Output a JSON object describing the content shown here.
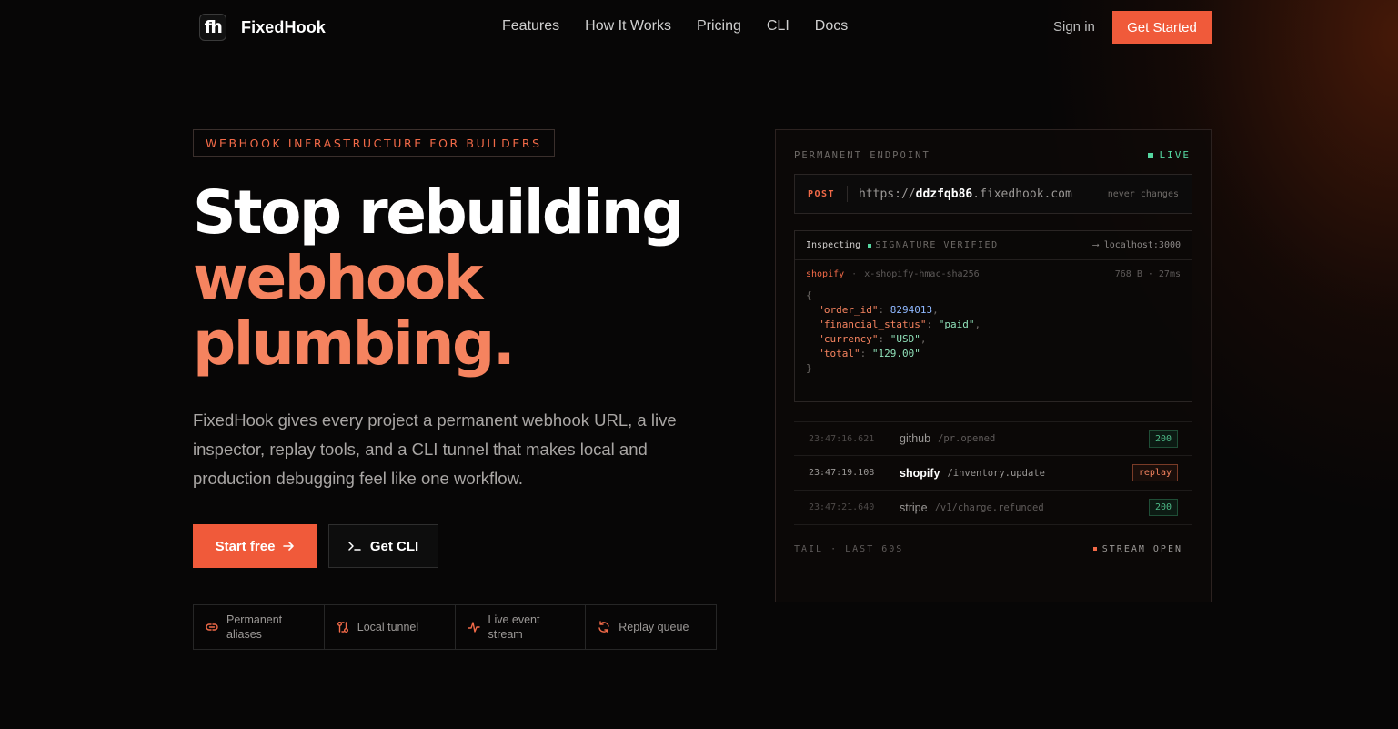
{
  "nav": {
    "logo_mark": "fh",
    "brand": "FixedHook",
    "links": [
      "Features",
      "How It Works",
      "Pricing",
      "CLI",
      "Docs"
    ],
    "signin": "Sign in",
    "cta": "Get Started"
  },
  "hero": {
    "tag": "WEBHOOK INFRASTRUCTURE FOR BUILDERS",
    "headline_1": "Stop rebuilding",
    "headline_2": "webhook",
    "headline_3": "plumbing.",
    "lede": "FixedHook gives every project a permanent webhook URL, a live inspector, replay tools, and a CLI tunnel that makes local and production debugging feel like one workflow.",
    "primary_cta": "Start free",
    "secondary_cta": "Get CLI",
    "features": [
      {
        "label": "Permanent aliases",
        "icon": "link-icon"
      },
      {
        "label": "Local tunnel",
        "icon": "tunnel-icon"
      },
      {
        "label": "Live event stream",
        "icon": "pulse-icon"
      },
      {
        "label": "Replay queue",
        "icon": "refresh-icon"
      }
    ]
  },
  "panel": {
    "label": "PERMANENT ENDPOINT",
    "live": "LIVE",
    "method": "POST",
    "url_prefix": "https://",
    "url_id": "ddzfqb86",
    "url_suffix": ".fixedhook.com",
    "url_note": "never changes",
    "inspector": {
      "title": "Inspecting",
      "verified": "SIGNATURE VERIFIED",
      "route": "⟶ localhost:3000",
      "source": "shopify",
      "header": "x-shopify-hmac-sha256",
      "meta": "768 B · 27ms",
      "payload": {
        "order_id_key": "\"order_id\"",
        "order_id_val": "8294013",
        "financial_status_key": "\"financial_status\"",
        "financial_status_val": "\"paid\"",
        "currency_key": "\"currency\"",
        "currency_val": "\"USD\"",
        "total_key": "\"total\"",
        "total_val": "\"129.00\""
      }
    },
    "events": [
      {
        "time": "23:47:16.621",
        "source": "github",
        "path": "/pr.opened",
        "badge": "200"
      },
      {
        "time": "23:47:19.108",
        "source": "shopify",
        "path": "/inventory.update",
        "badge": "replay"
      },
      {
        "time": "23:47:21.640",
        "source": "stripe",
        "path": "/v1/charge.refunded",
        "badge": "200"
      }
    ],
    "footer_left": "TAIL · LAST 60S",
    "footer_right": "STREAM OPEN"
  },
  "colors": {
    "accent": "#f05a3a",
    "accent_light": "#f5835f",
    "live_green": "#55d6a0"
  }
}
